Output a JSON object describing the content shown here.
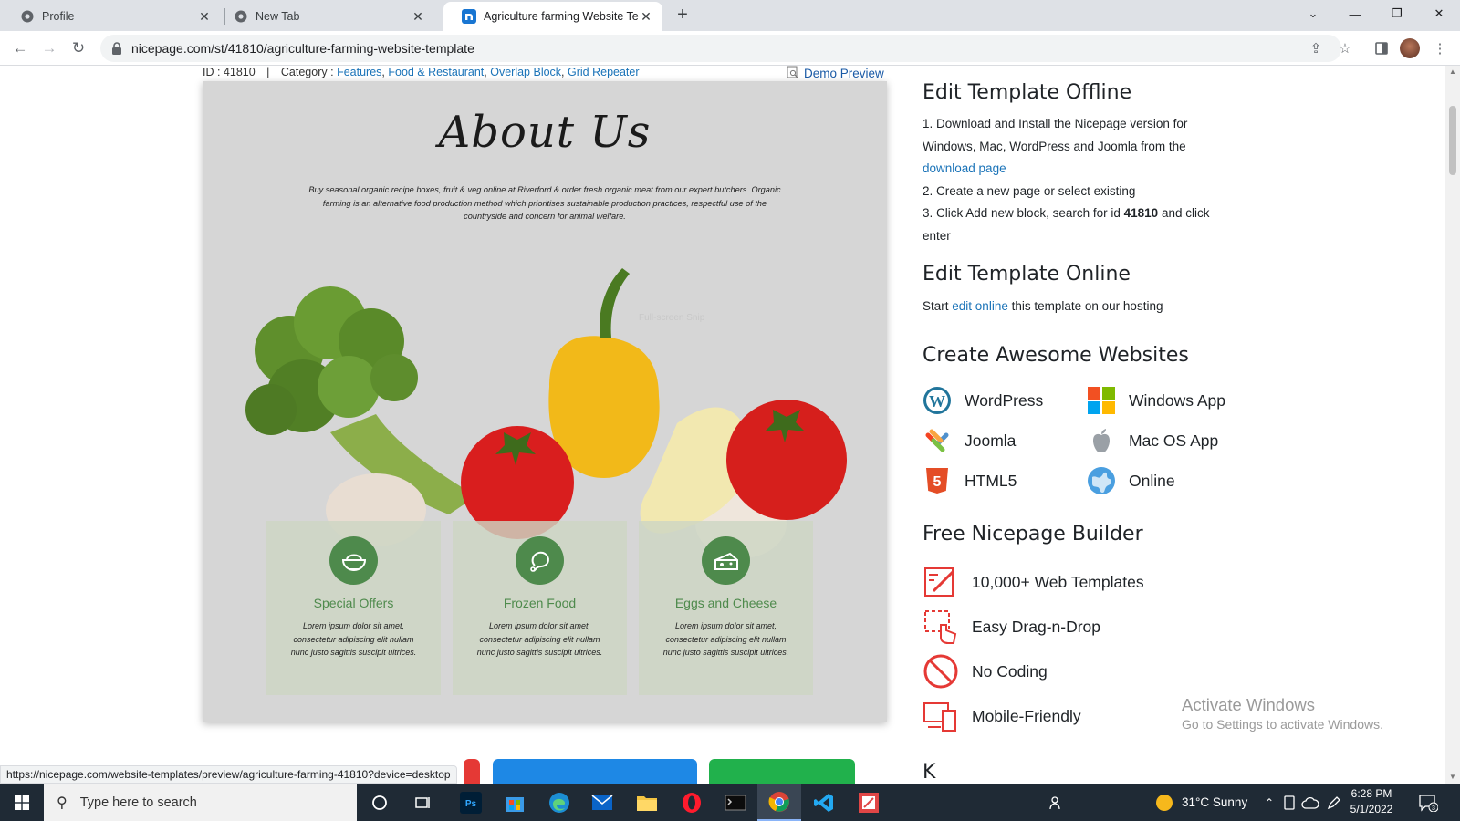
{
  "browser": {
    "tabs": [
      {
        "title": "Profile",
        "icon": "chrome-icon",
        "active": false
      },
      {
        "title": "New Tab",
        "icon": "chrome-icon",
        "active": false
      },
      {
        "title": "Agriculture farming Website Tem",
        "icon": "nicepage-icon",
        "active": true
      }
    ],
    "url": "nicepage.com/st/41810/agriculture-farming-website-template",
    "status_url": "https://nicepage.com/website-templates/preview/agriculture-farming-41810?device=desktop"
  },
  "template": {
    "id_text": "ID : 41810",
    "category_label": "Category :",
    "categories": [
      "Features",
      "Food & Restaurant",
      "Overlap Block",
      "Grid Repeater"
    ],
    "demo_preview": "Demo Preview"
  },
  "preview": {
    "title": "About Us",
    "text": "Buy seasonal organic recipe boxes, fruit & veg online at Riverford & order fresh organic meat from our expert butchers. Organic farming is an alternative food production method which prioritises sustainable production practices, respectful use of the countryside and concern for animal welfare.",
    "watermark": "Full-screen Snip",
    "cards": [
      {
        "title": "Special Offers",
        "icon": "food-bowl-icon",
        "text": "Lorem ipsum dolor sit amet, consectetur adipiscing elit nullam nunc justo sagittis suscipit ultrices."
      },
      {
        "title": "Frozen Food",
        "icon": "chicken-leg-icon",
        "text": "Lorem ipsum dolor sit amet, consectetur adipiscing elit nullam nunc justo sagittis suscipit ultrices."
      },
      {
        "title": "Eggs and Cheese",
        "icon": "cheese-icon",
        "text": "Lorem ipsum dolor sit amet, consectetur adipiscing elit nullam nunc justo sagittis suscipit ultrices."
      }
    ]
  },
  "sidebar": {
    "offline_title": "Edit Template Offline",
    "offline_step1": "1. Download and Install the Nicepage version for Windows, Mac, WordPress and Joomla from the",
    "offline_link": "download page",
    "offline_step2": "2. Create a new page or select existing",
    "offline_step3_pre": "3. Click Add new block, search for id",
    "offline_step3_id": "41810",
    "offline_step3_post": "and click enter",
    "online_title": "Edit Template Online",
    "online_pre": "Start",
    "online_link": "edit online",
    "online_post": "this template on our hosting",
    "create_title": "Create Awesome Websites",
    "apps": [
      "WordPress",
      "Windows App",
      "Joomla",
      "Mac OS App",
      "HTML5",
      "Online"
    ],
    "builder_title": "Free Nicepage Builder",
    "features": [
      "10,000+ Web Templates",
      "Easy Drag-n-Drop",
      "No Coding",
      "Mobile-Friendly"
    ],
    "next_heading_partial": "K"
  },
  "windows_notice": {
    "line1": "Activate Windows",
    "line2": "Go to Settings to activate Windows."
  },
  "taskbar": {
    "search_placeholder": "Type here to search",
    "weather": "31°C  Sunny",
    "time": "6:28 PM",
    "date": "5/1/2022",
    "notification_count": "3"
  },
  "colors": {
    "link": "#1a73b8",
    "card_green": "#4e8a4c",
    "feature_red": "#e53935",
    "taskbar": "#1f2a35"
  }
}
